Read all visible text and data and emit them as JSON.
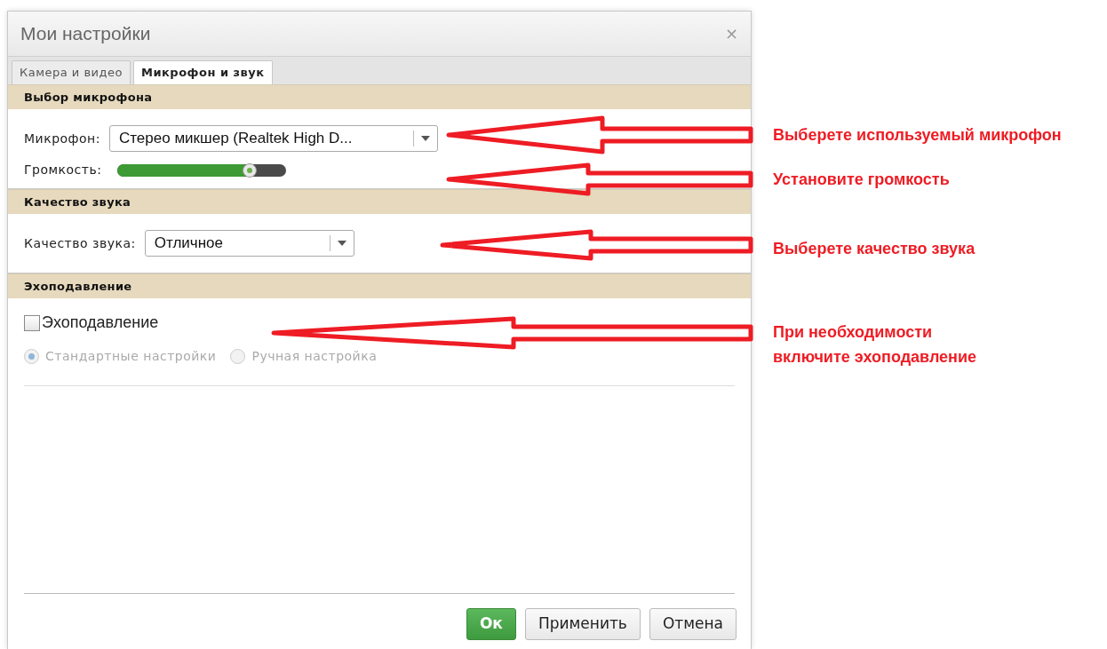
{
  "window": {
    "title": "Мои настройки",
    "close": "×"
  },
  "tabs": [
    {
      "label": "Камера и видео",
      "selected": false
    },
    {
      "label": "Микрофон и звук",
      "selected": true
    }
  ],
  "sections": [
    {
      "title": "Выбор микрофона",
      "fields": [
        {
          "kind": "select",
          "label": "Микрофон:",
          "value": "Стерео микшер (Realtek High D..."
        },
        {
          "kind": "slider",
          "label": "Громкость:",
          "level": 0.78
        }
      ]
    },
    {
      "title": "Качество звука",
      "fields": [
        {
          "kind": "select",
          "label": "Качество звука:",
          "value": "Отличное"
        }
      ]
    },
    {
      "title": "Эхоподавление",
      "fields": [
        {
          "kind": "checkbox",
          "label": "Эхоподавление",
          "checked": false
        },
        {
          "kind": "radios",
          "disabled": true,
          "options": [
            {
              "label": "Стандартные настройки",
              "selected": true
            },
            {
              "label": "Ручная настройка",
              "selected": false
            }
          ]
        }
      ]
    }
  ],
  "buttons": [
    {
      "label": "Ок",
      "primary": true
    },
    {
      "label": "Применить",
      "primary": false
    },
    {
      "label": "Отмена",
      "primary": false
    }
  ],
  "annotations": [
    {
      "text": "Выберете используемый микрофон"
    },
    {
      "text": "Установите громкость"
    },
    {
      "text": "Выберете качество звука"
    },
    {
      "text": "При необходимости\nвключите эхоподавление"
    }
  ]
}
